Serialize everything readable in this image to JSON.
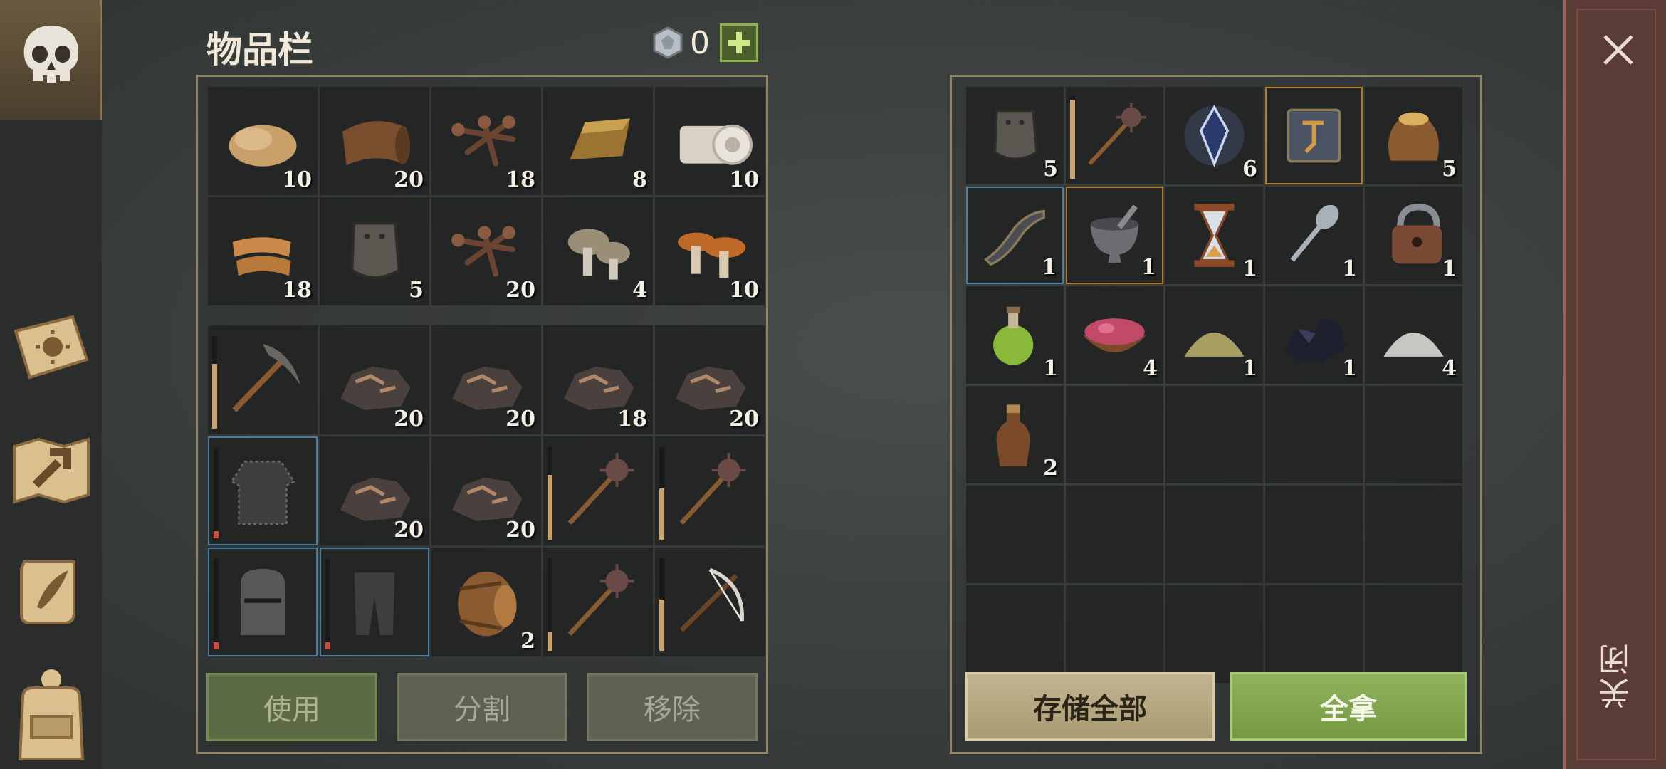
{
  "inventory": {
    "title": "物品栏",
    "currency": {
      "icon": "gem-icon",
      "count": "0"
    },
    "add_icon": "plus-icon",
    "top_grid": [
      {
        "icon": "leather-roll-icon",
        "count": "10"
      },
      {
        "icon": "leather-hide-icon",
        "count": "20"
      },
      {
        "icon": "nails-icon",
        "count": "18"
      },
      {
        "icon": "iron-ingot-icon",
        "count": "8"
      },
      {
        "icon": "cloth-roll-icon",
        "count": "10"
      },
      {
        "icon": "rope-fiber-icon",
        "count": "18"
      },
      {
        "icon": "iron-plate-icon",
        "count": "5"
      },
      {
        "icon": "nails-icon",
        "count": "20"
      },
      {
        "icon": "spotted-mushroom-icon",
        "count": "4"
      },
      {
        "icon": "orange-mushroom-icon",
        "count": "10"
      }
    ],
    "bottom_grid": [
      {
        "icon": "pickaxe-icon",
        "count": "",
        "durability": 0.7,
        "dura_color": "#c9a36b"
      },
      {
        "icon": "ore-icon",
        "count": "20"
      },
      {
        "icon": "ore-icon",
        "count": "20"
      },
      {
        "icon": "ore-icon",
        "count": "18"
      },
      {
        "icon": "ore-icon",
        "count": "20"
      },
      {
        "icon": "chainmail-armor-icon",
        "count": "",
        "durability": 0.08,
        "dura_color": "#d04a3a",
        "frame": "blue"
      },
      {
        "icon": "ore-icon",
        "count": "20"
      },
      {
        "icon": "ore-icon",
        "count": "20"
      },
      {
        "icon": "mace-icon",
        "count": "",
        "durability": 0.7,
        "dura_color": "#c9a36b"
      },
      {
        "icon": "mace-icon",
        "count": "",
        "durability": 0.55,
        "dura_color": "#c9a36b"
      },
      {
        "icon": "great-helm-icon",
        "count": "",
        "durability": 0.08,
        "dura_color": "#d04a3a",
        "frame": "blue"
      },
      {
        "icon": "chainmail-leggings-icon",
        "count": "",
        "durability": 0.08,
        "dura_color": "#d04a3a",
        "frame": "blue"
      },
      {
        "icon": "barrel-icon",
        "count": "2"
      },
      {
        "icon": "mace-icon",
        "count": "",
        "durability": 0.2,
        "dura_color": "#c9a36b"
      },
      {
        "icon": "crossbow-icon",
        "count": "",
        "durability": 0.55,
        "dura_color": "#c9a36b"
      }
    ],
    "buttons": {
      "use": "使用",
      "split": "分割",
      "remove": "移除"
    }
  },
  "container": {
    "grid": [
      {
        "icon": "iron-plate-icon",
        "count": "5"
      },
      {
        "icon": "mace-icon",
        "count": "",
        "durability": 0.95,
        "dura_color": "#c9a36b"
      },
      {
        "icon": "crystal-icon",
        "count": "6"
      },
      {
        "icon": "recipe-book-icon",
        "count": "",
        "frame": "orange"
      },
      {
        "icon": "grain-sack-icon",
        "count": "5"
      },
      {
        "icon": "bow-limb-icon",
        "count": "1",
        "frame": "blue"
      },
      {
        "icon": "mortar-icon",
        "count": "1",
        "frame": "orange"
      },
      {
        "icon": "hourglass-icon",
        "count": "1"
      },
      {
        "icon": "spoon-icon",
        "count": "1"
      },
      {
        "icon": "padlock-icon",
        "count": "1"
      },
      {
        "icon": "potion-icon",
        "count": "1"
      },
      {
        "icon": "raw-meat-bowl-icon",
        "count": "4"
      },
      {
        "icon": "sulfur-powder-icon",
        "count": "1"
      },
      {
        "icon": "coal-icon",
        "count": "1"
      },
      {
        "icon": "salt-powder-icon",
        "count": "4"
      },
      {
        "icon": "bottle-icon",
        "count": "2"
      },
      {
        "icon": "",
        "count": ""
      },
      {
        "icon": "",
        "count": ""
      },
      {
        "icon": "",
        "count": ""
      },
      {
        "icon": "",
        "count": ""
      },
      {
        "icon": "",
        "count": ""
      },
      {
        "icon": "",
        "count": ""
      },
      {
        "icon": "",
        "count": ""
      },
      {
        "icon": "",
        "count": ""
      },
      {
        "icon": "",
        "count": ""
      },
      {
        "icon": "",
        "count": ""
      },
      {
        "icon": "",
        "count": ""
      },
      {
        "icon": "",
        "count": ""
      },
      {
        "icon": "",
        "count": ""
      },
      {
        "icon": "",
        "count": ""
      }
    ],
    "buttons": {
      "store_all": "存储全部",
      "take_all": "全拿"
    }
  },
  "nav": {
    "items": [
      "skull-icon",
      "sun-book-icon",
      "craft-map-icon",
      "quest-scroll-icon",
      "backpack-icon"
    ]
  },
  "close": {
    "label": "关闭",
    "icon": "close-icon"
  }
}
